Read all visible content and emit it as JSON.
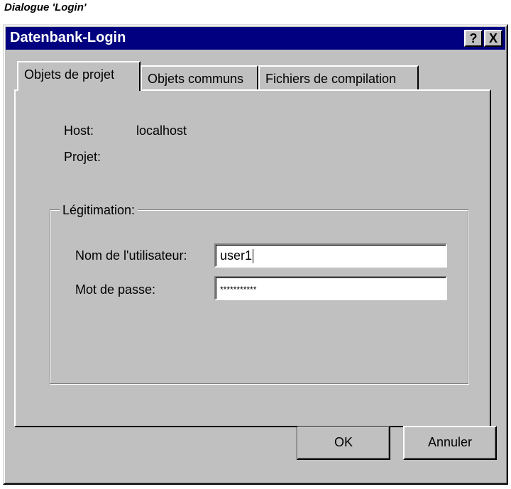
{
  "caption": "Dialogue 'Login'",
  "window": {
    "title": "Datenbank-Login",
    "help_label": "?",
    "close_label": "X"
  },
  "tabs": [
    {
      "label": "Objets de projet",
      "active": true
    },
    {
      "label": "Objets communs",
      "active": false
    },
    {
      "label": "Fichiers de compilation",
      "active": false
    }
  ],
  "info": {
    "host_label": "Host:",
    "host_value": "localhost",
    "project_label": "Projet:",
    "project_value": ""
  },
  "auth": {
    "legend": "Légitimation:",
    "username_label": "Nom de l'utilisateur:",
    "username_value": "user1",
    "password_label": "Mot de passe:",
    "password_masked": "***********"
  },
  "buttons": {
    "ok_label": "OK",
    "cancel_label": "Annuler"
  },
  "colors": {
    "titlebar": "#000080",
    "face": "#c0c0c0"
  }
}
